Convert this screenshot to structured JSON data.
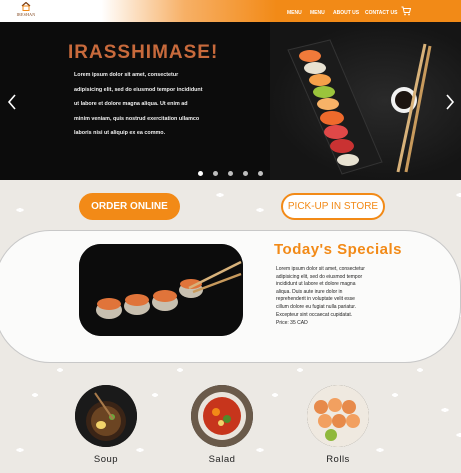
{
  "header": {
    "logo_text": "IRESHAN",
    "nav": [
      "MENU",
      "MENU",
      "ABOUT US",
      "CONTACT US"
    ],
    "cart_icon": "cart-icon"
  },
  "hero": {
    "title": "IRASSHIMASE!",
    "lines": [
      "Lorem ipsum dolor sit amet, consectetur",
      "adipisicing elit, sed do eiusmod tempor incididunt",
      "ut labore et dolore magna aliqua. Ut enim ad",
      "minim veniam, quis nostrud exercitation ullamco",
      "laboris nisi ut aliquip ex ea commo."
    ],
    "left_arrow_icon": "chevron-left-icon",
    "right_arrow_icon": "chevron-right-icon",
    "slide_count": 5,
    "active_slide": 0
  },
  "actions": {
    "order_online": "ORDER ONLINE",
    "pickup": "PICK-UP IN STORE"
  },
  "specials": {
    "title": "Today's Specials",
    "description": "Lorem ipsum dolor sit amet, consectetur adipisicing elit, sed do eiusmod tempor incididunt ut labore et dolore magna aliqua. Duis aute irure dolor in reprehenderit in voluptate velit esse cillum dolore eu fugiat nulla pariatur. Excepteur sint occaecat cupidatat.",
    "price": "Price: 35 CAD"
  },
  "categories": [
    {
      "label": "Soup"
    },
    {
      "label": "Salad"
    },
    {
      "label": "Rolls"
    }
  ],
  "colors": {
    "accent": "#f28a17",
    "title_brown": "#c86a3c"
  }
}
